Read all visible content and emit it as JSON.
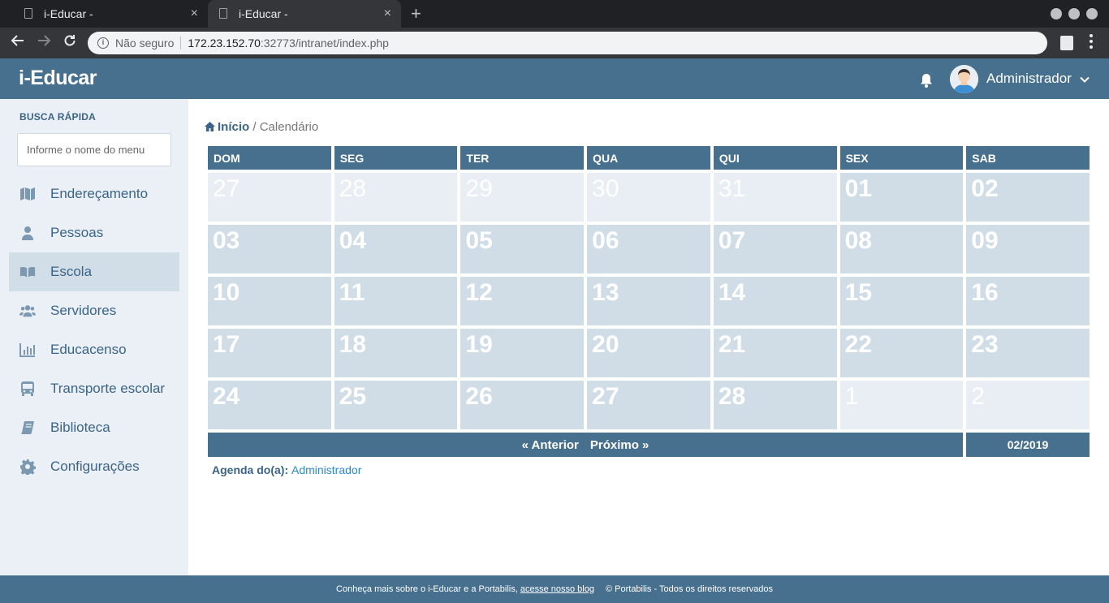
{
  "browser": {
    "tabs": [
      {
        "title": "i-Educar -",
        "close": "×"
      },
      {
        "title": "i-Educar -",
        "close": "×"
      }
    ],
    "new_tab": "+",
    "security": "Não seguro",
    "url_host": "172.23.152.70",
    "url_rest": ":32773/intranet/index.php"
  },
  "header": {
    "brand": "i-Educar",
    "user": "Administrador"
  },
  "sidebar": {
    "quick_label": "BUSCA RÁPIDA",
    "quick_placeholder": "Informe o nome do menu",
    "items": [
      {
        "label": "Endereçamento",
        "icon": "map-icon"
      },
      {
        "label": "Pessoas",
        "icon": "person-icon"
      },
      {
        "label": "Escola",
        "icon": "book-open-icon"
      },
      {
        "label": "Servidores",
        "icon": "users-icon"
      },
      {
        "label": "Educacenso",
        "icon": "bar-chart-icon"
      },
      {
        "label": "Transporte escolar",
        "icon": "bus-icon"
      },
      {
        "label": "Biblioteca",
        "icon": "book-icon"
      },
      {
        "label": "Configurações",
        "icon": "gear-icon"
      }
    ],
    "active_index": 2
  },
  "breadcrumb": {
    "home": "Início",
    "separator": "/",
    "current": "Calendário"
  },
  "calendar": {
    "weekdays": [
      "DOM",
      "SEG",
      "TER",
      "QUA",
      "QUI",
      "SEX",
      "SAB"
    ],
    "days": [
      {
        "d": "27",
        "out": true
      },
      {
        "d": "28",
        "out": true
      },
      {
        "d": "29",
        "out": true
      },
      {
        "d": "30",
        "out": true
      },
      {
        "d": "31",
        "out": true
      },
      {
        "d": "01",
        "out": false
      },
      {
        "d": "02",
        "out": false
      },
      {
        "d": "03",
        "out": false
      },
      {
        "d": "04",
        "out": false
      },
      {
        "d": "05",
        "out": false
      },
      {
        "d": "06",
        "out": false
      },
      {
        "d": "07",
        "out": false
      },
      {
        "d": "08",
        "out": false
      },
      {
        "d": "09",
        "out": false
      },
      {
        "d": "10",
        "out": false
      },
      {
        "d": "11",
        "out": false
      },
      {
        "d": "12",
        "out": false
      },
      {
        "d": "13",
        "out": false
      },
      {
        "d": "14",
        "out": false
      },
      {
        "d": "15",
        "out": false
      },
      {
        "d": "16",
        "out": false
      },
      {
        "d": "17",
        "out": false
      },
      {
        "d": "18",
        "out": false
      },
      {
        "d": "19",
        "out": false
      },
      {
        "d": "20",
        "out": false
      },
      {
        "d": "21",
        "out": false
      },
      {
        "d": "22",
        "out": false
      },
      {
        "d": "23",
        "out": false
      },
      {
        "d": "24",
        "out": false
      },
      {
        "d": "25",
        "out": false
      },
      {
        "d": "26",
        "out": false
      },
      {
        "d": "27",
        "out": false
      },
      {
        "d": "28",
        "out": false
      },
      {
        "d": "1",
        "out": true
      },
      {
        "d": "2",
        "out": true
      }
    ],
    "prev_label": "« Anterior",
    "next_label": "Próximo »",
    "month_label": "02/2019"
  },
  "agenda": {
    "label": "Agenda do(a):",
    "user": "Administrador"
  },
  "footer": {
    "text": "Conheça mais sobre o i-Educar e a Portabilis,",
    "link": "acesse nosso blog",
    "copyright": "© Portabilis - Todos os direitos reservados"
  },
  "colors": {
    "header_bg": "#47708f",
    "sidebar_bg": "#eaf0f5",
    "cell_bg": "#d0dde7",
    "cell_out_bg": "#e8eef4"
  }
}
